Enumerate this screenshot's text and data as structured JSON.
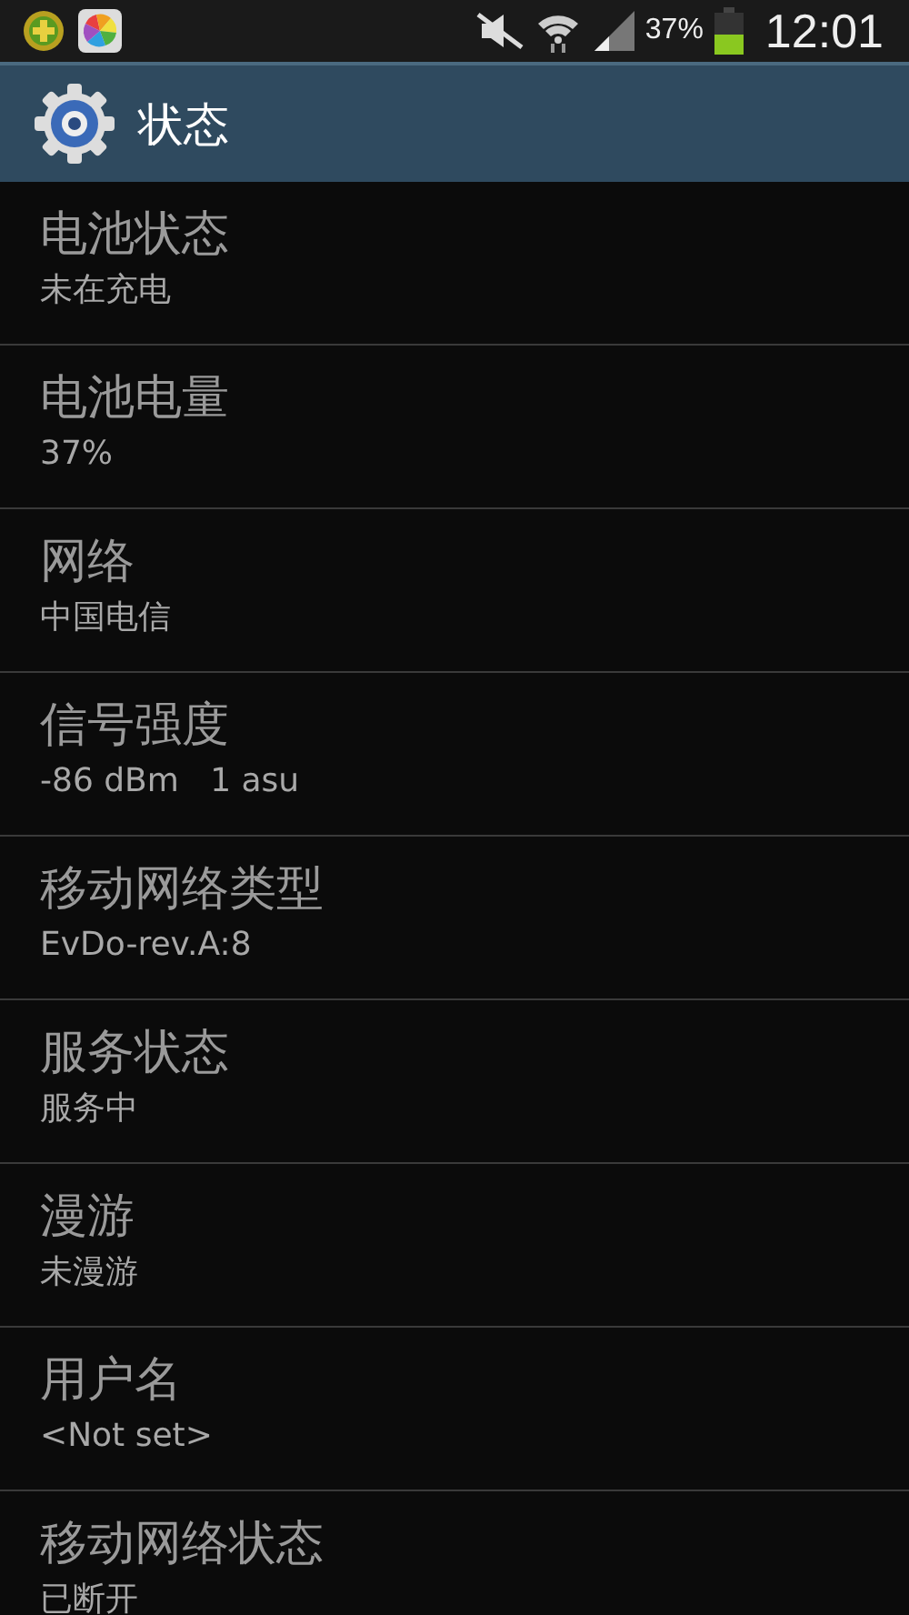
{
  "status_bar": {
    "battery_text": "37%",
    "time": "12:01"
  },
  "header": {
    "title": "状态"
  },
  "items": [
    {
      "title": "电池状态",
      "value": "未在充电"
    },
    {
      "title": "电池电量",
      "value": "37%"
    },
    {
      "title": "网络",
      "value": "中国电信"
    },
    {
      "title": "信号强度",
      "value": "-86 dBm   1 asu"
    },
    {
      "title": "移动网络类型",
      "value": "EvDo-rev.A:8"
    },
    {
      "title": "服务状态",
      "value": "服务中"
    },
    {
      "title": "漫游",
      "value": "未漫游"
    },
    {
      "title": "用户名",
      "value": "<Not set>"
    },
    {
      "title": "移动网络状态",
      "value": "已断开"
    }
  ]
}
